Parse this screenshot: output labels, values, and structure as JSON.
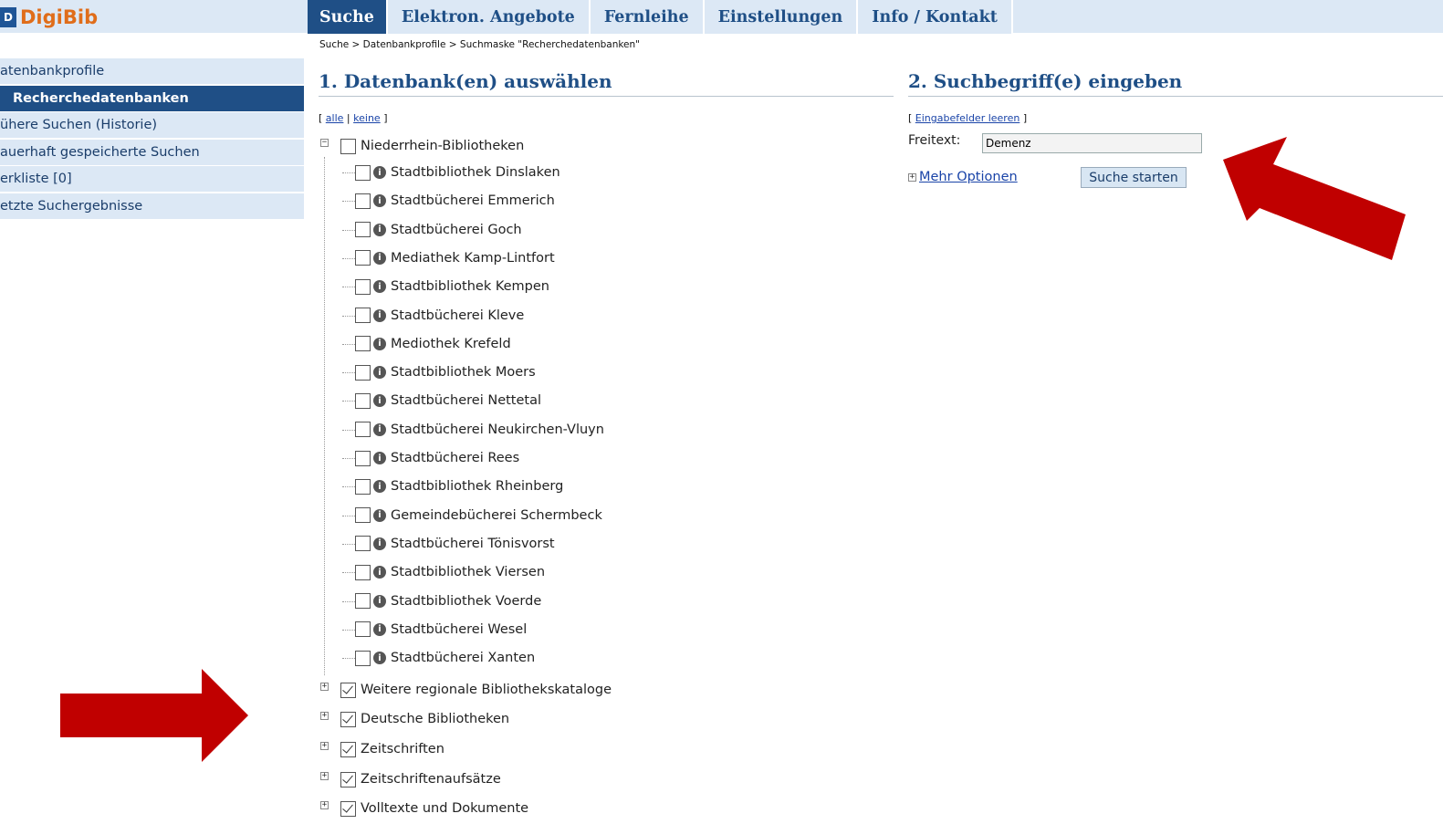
{
  "logo": {
    "mark": "D",
    "text": "DigiBib"
  },
  "nav": {
    "tabs": [
      "Suche",
      "Elektron. Angebote",
      "Fernleihe",
      "Einstellungen",
      "Info / Kontakt"
    ]
  },
  "breadcrumb": "Suche > Datenbankprofile > Suchmaske \"Recherchedatenbanken\"",
  "sidebar": {
    "items": [
      "atenbankprofile",
      "Recherchedatenbanken",
      "ühere Suchen (Historie)",
      "auerhaft gespeicherte Suchen",
      "erkliste [0]",
      "etzte Suchergebnisse"
    ]
  },
  "section1": {
    "title": "1. Datenbank(en) auswählen",
    "select_prefix": "[",
    "select_all": "alle",
    "select_sep": "|",
    "select_none": "keine",
    "select_suffix": "]",
    "group": "Niederrhein-Bibliotheken",
    "libraries": [
      "Stadtbibliothek Dinslaken",
      "Stadtbücherei Emmerich",
      "Stadtbücherei Goch",
      "Mediathek Kamp-Lintfort",
      "Stadtbibliothek Kempen",
      "Stadtbücherei Kleve",
      "Mediothek Krefeld",
      "Stadtbibliothek Moers",
      "Stadtbücherei Nettetal",
      "Stadtbücherei Neukirchen-Vluyn",
      "Stadtbücherei Rees",
      "Stadtbibliothek Rheinberg",
      "Gemeindebücherei Schermbeck",
      "Stadtbücherei Tönisvorst",
      "Stadtbibliothek Viersen",
      "Stadtbibliothek Voerde",
      "Stadtbücherei Wesel",
      "Stadtbücherei Xanten"
    ],
    "groups_checked": [
      "Weitere regionale Bibliothekskataloge",
      "Deutsche Bibliotheken",
      "Zeitschriften",
      "Zeitschriftenaufsätze",
      "Volltexte und Dokumente"
    ]
  },
  "section2": {
    "title": "2. Suchbegriff(e) eingeben",
    "clear_prefix": "[",
    "clear_link": "Eingabefelder leeren",
    "clear_suffix": "]",
    "freitext_label": "Freitext:",
    "freitext_value": "Demenz",
    "more_options": "Mehr Optionen",
    "search_button": "Suche starten"
  },
  "colors": {
    "nav_bg": "#dce8f5",
    "accent": "#1f4f86",
    "logo": "#e06d1a",
    "arrow": "#c00000"
  },
  "icons": [
    "info-icon",
    "expand-icon",
    "collapse-icon",
    "red-arrow"
  ]
}
